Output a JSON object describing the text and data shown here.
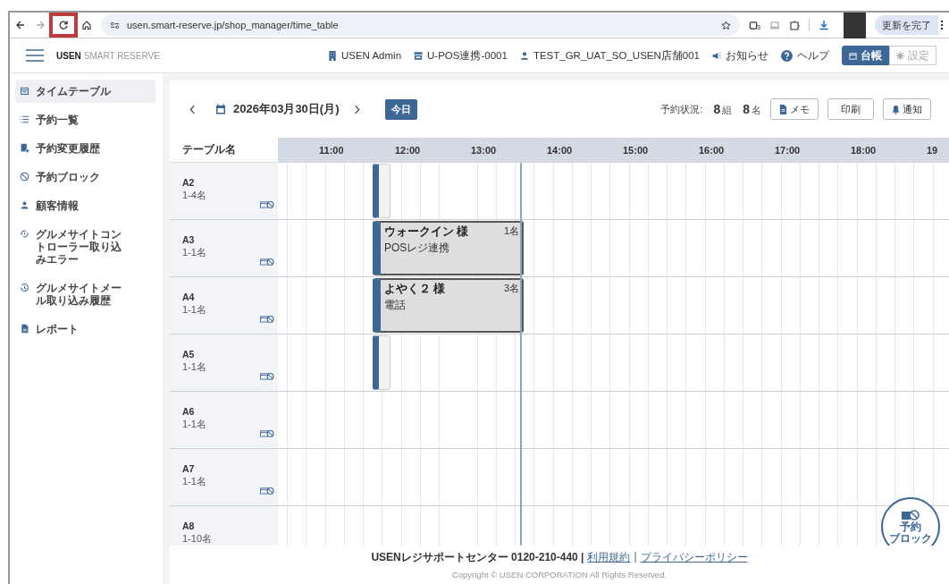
{
  "browser": {
    "url": "usen.smart-reserve.jp/shop_manager/time_table",
    "update_button": "更新を完了",
    "extension_badge": "3",
    "reload_highlighted": true
  },
  "header": {
    "brand": "USEN",
    "brand_sub": "SMART RESERVE",
    "items": [
      "USEN Admin",
      "U-POS連携-0001",
      "TEST_GR_UAT_SO_USEN店舗001",
      "お知らせ",
      "ヘルプ"
    ],
    "modes": [
      {
        "label": "台帳",
        "selected": true
      },
      {
        "label": "設定",
        "selected": false
      }
    ]
  },
  "sidebar": {
    "items": [
      {
        "label": "タイムテーブル",
        "selected": true
      },
      {
        "label": "予約一覧",
        "selected": false
      },
      {
        "label": "予約変更履歴",
        "selected": false
      },
      {
        "label": "予約ブロック",
        "selected": false
      },
      {
        "label": "顧客情報",
        "selected": false
      },
      {
        "label": "グルメサイトコントローラー取り込みエラー",
        "selected": false
      },
      {
        "label": "グルメサイトメール取り込み履歴",
        "selected": false
      },
      {
        "label": "レポート",
        "selected": false
      }
    ]
  },
  "toolbar": {
    "date": "2026年03月30日(月)",
    "today": "今日",
    "status_label": "予約状況:",
    "groups": "8",
    "groups_unit": "組",
    "people": "8",
    "people_unit": "名",
    "buttons": [
      "メモ",
      "印刷",
      "通知"
    ]
  },
  "timetable": {
    "name_header": "テーブル名",
    "hours": [
      "11:00",
      "12:00",
      "13:00",
      "14:00",
      "15:00",
      "16:00",
      "17:00",
      "18:00",
      "19"
    ],
    "rows": [
      {
        "name": "A2",
        "capacity": "1-4名",
        "block_icon": true,
        "booking": {
          "kind": "short"
        }
      },
      {
        "name": "A3",
        "capacity": "1-1名",
        "block_icon": true,
        "booking": {
          "kind": "full",
          "guest": "ウォークイン 様",
          "party": "1名",
          "source": "POSレジ連携"
        }
      },
      {
        "name": "A4",
        "capacity": "1-1名",
        "block_icon": true,
        "booking": {
          "kind": "full",
          "guest": "よやく２ 様",
          "party": "3名",
          "source": "電話"
        }
      },
      {
        "name": "A5",
        "capacity": "1-1名",
        "block_icon": true,
        "booking": {
          "kind": "short"
        }
      },
      {
        "name": "A6",
        "capacity": "1-1名",
        "block_icon": true
      },
      {
        "name": "A7",
        "capacity": "1-1名",
        "block_icon": true
      },
      {
        "name": "A8",
        "capacity": "1-10名",
        "block_icon": false
      }
    ]
  },
  "fab": {
    "label_lines": [
      "予約",
      "ブロック"
    ]
  },
  "footer": {
    "support": "USENレジサポートセンター 0120-210-440 |",
    "links": [
      "利用規約",
      "|",
      "プライバシーポリシー"
    ],
    "copyright": "Copyright © USEN CORPORATION All Rights Reserved."
  }
}
